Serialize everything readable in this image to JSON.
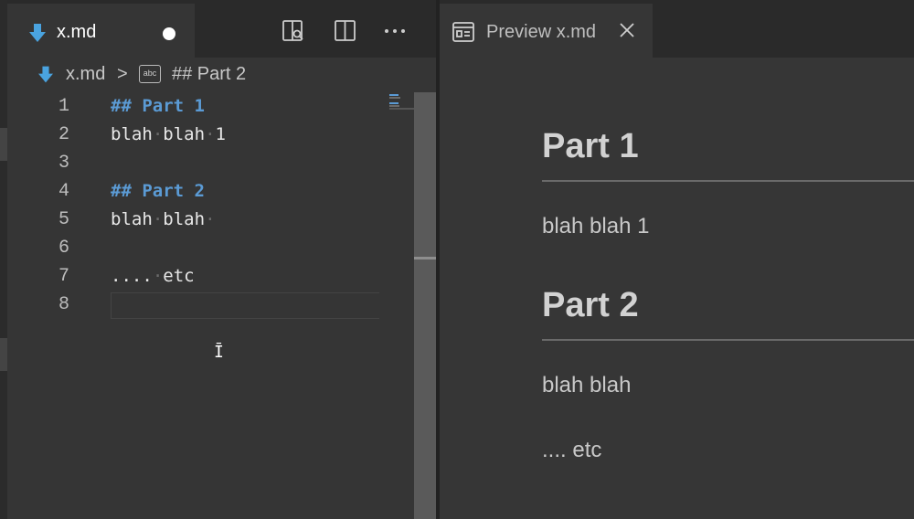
{
  "left_editor": {
    "tab": {
      "label": "x.md",
      "dirty": true,
      "icon": "markdown-file-icon"
    },
    "toolbar": [
      "open-preview-to-side-icon",
      "split-editor-icon",
      "more-actions-icon"
    ],
    "breadcrumb": {
      "file": "x.md",
      "separator": ">",
      "symbol_icon": "abc",
      "heading": "## Part 2"
    },
    "lines": [
      {
        "number": "1",
        "text": "## Part 1",
        "kind": "heading"
      },
      {
        "number": "2",
        "text": "blah·blah·1",
        "kind": "text"
      },
      {
        "number": "3",
        "text": "",
        "kind": "text"
      },
      {
        "number": "4",
        "text": "## Part 2",
        "kind": "heading"
      },
      {
        "number": "5",
        "text": "blah·blah·",
        "kind": "text"
      },
      {
        "number": "6",
        "text": "",
        "kind": "text"
      },
      {
        "number": "7",
        "text": "....·etc",
        "kind": "text"
      },
      {
        "number": "8",
        "text": "",
        "kind": "text"
      }
    ]
  },
  "right_editor": {
    "tab": {
      "label": "Preview x.md",
      "icon": "preview-icon",
      "close": "close-icon"
    },
    "preview": {
      "h1a": "Part 1",
      "p1": "blah blah 1",
      "h1b": "Part 2",
      "p2": "blah blah",
      "p3": ".... etc"
    }
  },
  "colors": {
    "heading_blue": "#5b9bd5",
    "markdown_icon": "#4aa3df",
    "editor_bg": "#353535",
    "tabbar_bg": "#2a2a2a"
  }
}
